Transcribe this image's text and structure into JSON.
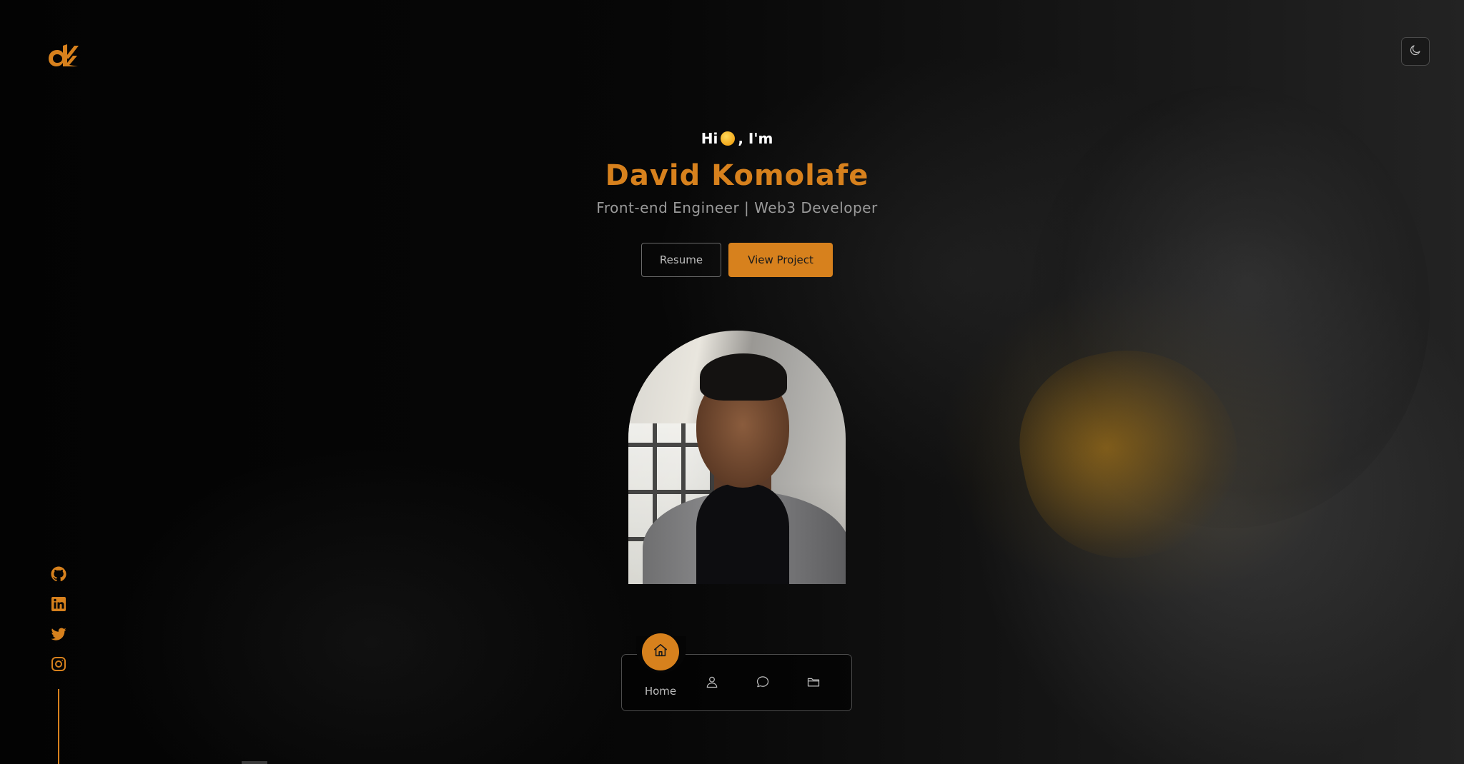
{
  "header": {
    "logo_text": "dK",
    "logo_icon": "dk-logo",
    "theme_toggle_icon": "moon-icon"
  },
  "hero": {
    "greeting_prefix": "Hi",
    "greeting_emoji": "smiling-face-emoji",
    "greeting_suffix": ", I'm",
    "name": "David Komolafe",
    "role": "Front-end Engineer | Web3 Developer",
    "buttons": {
      "resume_label": "Resume",
      "view_project_label": "View Project"
    }
  },
  "portrait": {
    "alt": "David Komolafe"
  },
  "social_links": [
    {
      "name": "github",
      "icon": "github-icon"
    },
    {
      "name": "linkedin",
      "icon": "linkedin-icon"
    },
    {
      "name": "twitter",
      "icon": "twitter-icon"
    },
    {
      "name": "instagram",
      "icon": "instagram-icon"
    }
  ],
  "bottom_nav": {
    "items": [
      {
        "label": "Home",
        "icon": "home-icon",
        "active": true
      },
      {
        "label": "",
        "icon": "user-icon",
        "active": false
      },
      {
        "label": "",
        "icon": "chat-icon",
        "active": false
      },
      {
        "label": "",
        "icon": "folder-icon",
        "active": false
      }
    ]
  },
  "colors": {
    "accent": "#d7811d",
    "background": "#050505",
    "muted_text": "#9a9a9a"
  }
}
